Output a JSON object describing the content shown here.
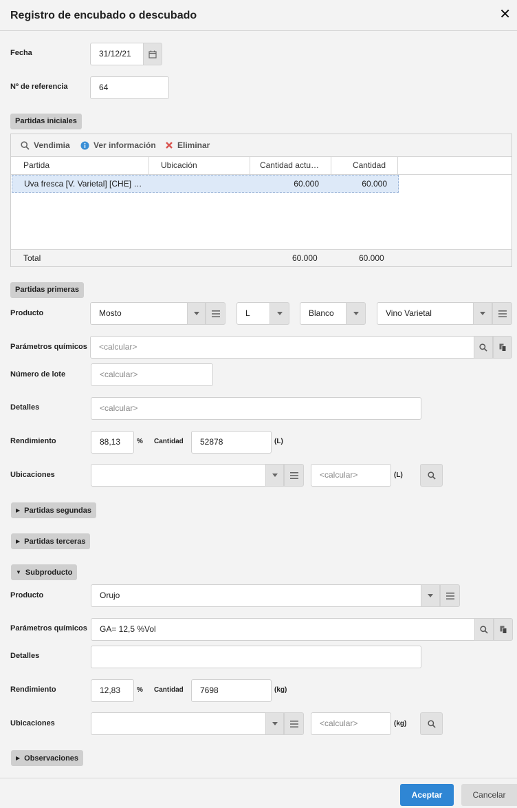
{
  "dialog": {
    "title": "Registro de encubado o descubado",
    "close_label": "✕"
  },
  "fecha": {
    "label": "Fecha",
    "value": "31/12/21"
  },
  "referencia": {
    "label": "Nº de referencia",
    "value": "64"
  },
  "partidas_iniciales": {
    "section_label": "Partidas iniciales",
    "toolbar": {
      "vendimia": "Vendimia",
      "ver_informacion": "Ver información",
      "eliminar": "Eliminar"
    },
    "columns": [
      "Partida",
      "Ubicación",
      "Cantidad actu…",
      "Cantidad"
    ],
    "rows": [
      {
        "partida": "Uva fresca [V. Varietal] [CHE] …",
        "ubicacion": "",
        "cantidad_actual": "60.000",
        "cantidad": "60.000"
      }
    ],
    "footer": {
      "label": "Total",
      "cantidad_actual": "60.000",
      "cantidad": "60.000"
    }
  },
  "partidas_primeras": {
    "section_label": "Partidas primeras",
    "producto_label": "Producto",
    "producto": "Mosto",
    "unidad": "L",
    "color": "Blanco",
    "variedad": "Vino Varietal",
    "parametros_label": "Parámetros químicos",
    "parametros_placeholder": "<calcular>",
    "lote_label": "Número de lote",
    "lote_placeholder": "<calcular>",
    "detalles_label": "Detalles",
    "detalles_placeholder": "<calcular>",
    "rendimiento_label": "Rendimiento",
    "rendimiento_value": "88,13",
    "percent": "%",
    "cantidad_label": "Cantidad",
    "cantidad_value": "52878",
    "cantidad_unit": "(L)",
    "ubicaciones_label": "Ubicaciones",
    "ubicaciones_value": "",
    "ubic_cantidad_placeholder": "<calcular>",
    "ubic_unit": "(L)"
  },
  "partidas_segundas": {
    "section_label": "Partidas segundas"
  },
  "partidas_terceras": {
    "section_label": "Partidas terceras"
  },
  "subproducto": {
    "section_label": "Subproducto",
    "producto_label": "Producto",
    "producto": "Orujo",
    "parametros_label": "Parámetros químicos",
    "parametros_value": "GA= 12,5  %Vol",
    "detalles_label": "Detalles",
    "detalles_value": "",
    "rendimiento_label": "Rendimiento",
    "rendimiento_value": "12,83",
    "percent": "%",
    "cantidad_label": "Cantidad",
    "cantidad_value": "7698",
    "cantidad_unit": "(kg)",
    "ubicaciones_label": "Ubicaciones",
    "ubicaciones_value": "",
    "ubic_cantidad_placeholder": "<calcular>",
    "ubic_unit": "(kg)"
  },
  "observaciones": {
    "section_label": "Observaciones"
  },
  "actions": {
    "aceptar": "Aceptar",
    "cancelar": "Cancelar"
  },
  "colors": {
    "primary": "#2f86d4",
    "selected_row": "#dde9f8",
    "delete_icon": "#d9534f",
    "info_icon": "#3a8fd6"
  }
}
